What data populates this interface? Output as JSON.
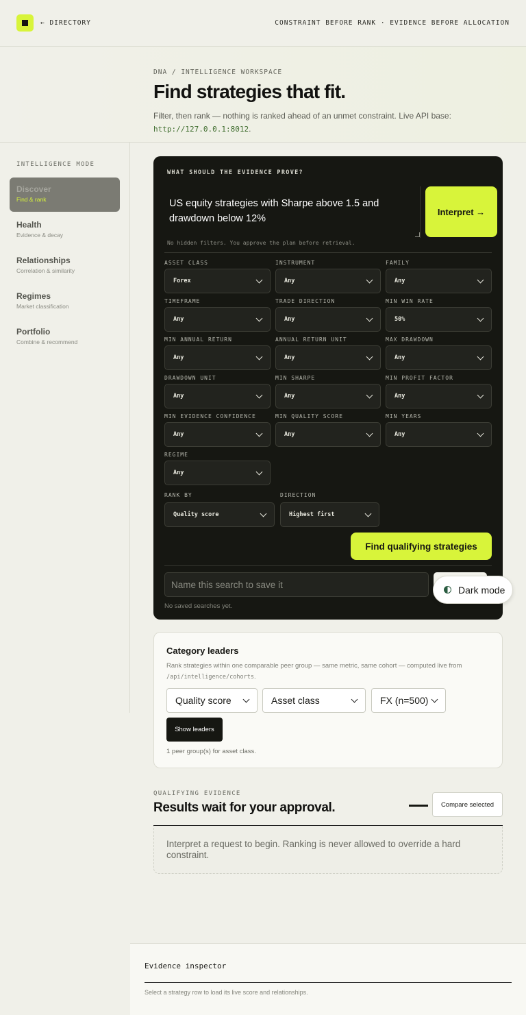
{
  "topbar": {
    "back_link": "← DIRECTORY",
    "tagline": "CONSTRAINT BEFORE RANK · EVIDENCE BEFORE ALLOCATION"
  },
  "header": {
    "breadcrumb": "DNA / INTELLIGENCE WORKSPACE",
    "title": "Find strategies that fit.",
    "subtitle": "Filter, then rank — nothing is ranked ahead of an unmet constraint. Live API base:",
    "api_base": "http://127.0.0.1:8012",
    "api_suffix": "."
  },
  "sidebar": {
    "label": "INTELLIGENCE MODE",
    "items": [
      {
        "title": "Discover",
        "sub": "Find & rank",
        "active": true
      },
      {
        "title": "Health",
        "sub": "Evidence & decay"
      },
      {
        "title": "Relationships",
        "sub": "Correlation & similarity"
      },
      {
        "title": "Regimes",
        "sub": "Market classification"
      },
      {
        "title": "Portfolio",
        "sub": "Combine & recommend"
      }
    ]
  },
  "panel": {
    "question_label": "WHAT SHOULD THE EVIDENCE PROVE?",
    "query_value": "US equity strategies with Sharpe above 1.5 and drawdown below 12%",
    "interpret_label": "Interpret →",
    "hint": "No hidden filters. You approve the plan before retrieval.",
    "filters": [
      {
        "label": "ASSET CLASS",
        "value": "Forex"
      },
      {
        "label": "INSTRUMENT",
        "value": "Any"
      },
      {
        "label": "FAMILY",
        "value": "Any"
      },
      {
        "label": "TIMEFRAME",
        "value": "Any"
      },
      {
        "label": "TRADE DIRECTION",
        "value": "Any"
      },
      {
        "label": "MIN WIN RATE",
        "value": "50%"
      },
      {
        "label": "MIN ANNUAL RETURN",
        "value": "Any"
      },
      {
        "label": "ANNUAL RETURN UNIT",
        "value": "Any"
      },
      {
        "label": "MAX DRAWDOWN",
        "value": "Any"
      },
      {
        "label": "DRAWDOWN UNIT",
        "value": "Any"
      },
      {
        "label": "MIN SHARPE",
        "value": "Any"
      },
      {
        "label": "MIN PROFIT FACTOR",
        "value": "Any"
      },
      {
        "label": "MIN EVIDENCE CONFIDENCE",
        "value": "Any"
      },
      {
        "label": "MIN QUALITY SCORE",
        "value": "Any"
      },
      {
        "label": "MIN YEARS",
        "value": "Any"
      },
      {
        "label": "REGIME",
        "value": "Any"
      }
    ],
    "rank_by": {
      "label": "RANK BY",
      "value": "Quality score"
    },
    "direction": {
      "label": "DIRECTION",
      "value": "Highest first"
    },
    "find_label": "Find qualifying strategies",
    "save_placeholder": "Name this search to save it",
    "no_saved": "No saved searches yet."
  },
  "dark_mode_label": "Dark mode",
  "leaders": {
    "title": "Category leaders",
    "desc": "Rank strategies within one comparable peer group — same metric, same cohort — computed live from",
    "endpoint": "/api/intelligence/cohorts",
    "endpoint_suffix": ".",
    "metric": "Quality score",
    "dimension": "Asset class",
    "cohort": "FX (n=500)",
    "show_label": "Show leaders",
    "count_text": "1 peer group(s) for asset class."
  },
  "evidence": {
    "eyebrow": "QUALIFYING EVIDENCE",
    "title": "Results wait for your approval.",
    "compare_label": "Compare selected",
    "empty_text": "Interpret a request to begin. Ranking is never allowed to override a hard constraint."
  },
  "inspector": {
    "title": "Evidence inspector",
    "desc": "Select a strategy row to load its live score and relationships."
  }
}
